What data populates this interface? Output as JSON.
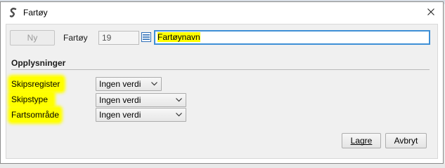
{
  "window": {
    "title": "Fartøy"
  },
  "toolbar": {
    "new_label": "Ny",
    "vessel_label": "Fartøy",
    "vessel_id": "19",
    "vessel_name": "Fartøynavn"
  },
  "section": {
    "title": "Opplysninger"
  },
  "fields": [
    {
      "label": "Skipsregister",
      "value": "Ingen verdi"
    },
    {
      "label": "Skipstype",
      "value": "Ingen verdi"
    },
    {
      "label": "Fartsområde",
      "value": "Ingen verdi"
    }
  ],
  "buttons": {
    "save_label": "Lagre",
    "cancel_label": "Avbryt"
  },
  "colors": {
    "highlight": "#ffff00",
    "focus_border": "#3d8fd6"
  },
  "icons": {
    "app": "app-logo-icon",
    "close": "close-icon",
    "lookup": "list-lookup-icon",
    "dropdown": "chevron-down-icon"
  }
}
